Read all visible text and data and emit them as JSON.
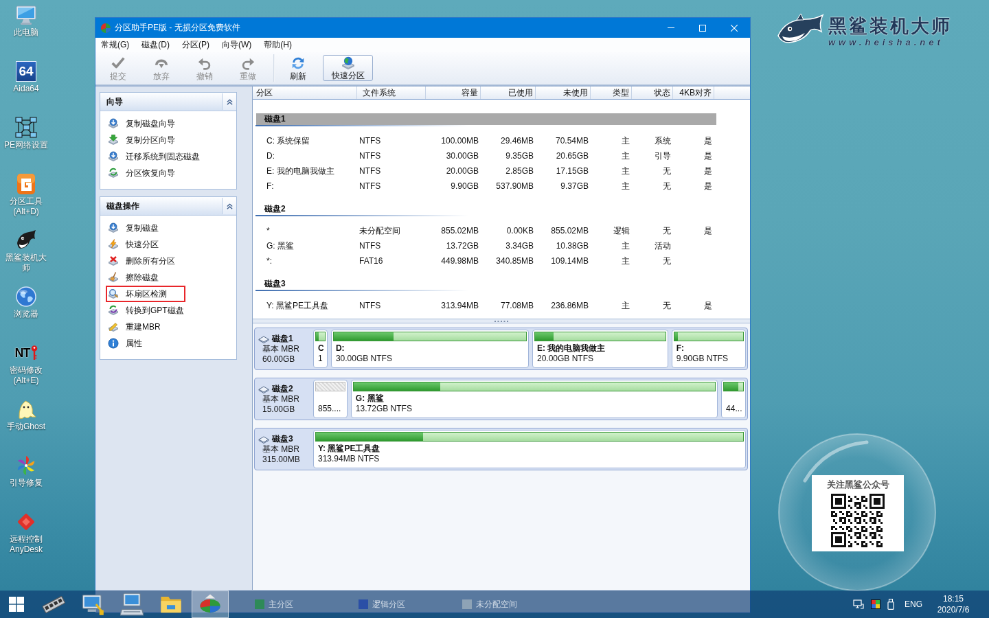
{
  "desktop_icons": [
    {
      "kind": "computer",
      "label": "此电脑"
    },
    {
      "kind": "aida",
      "label": "Aida64",
      "icon_text": "64"
    },
    {
      "kind": "network",
      "label": "PE网络设置"
    },
    {
      "kind": "partition-tool",
      "label": "分区工具(Alt+D)"
    },
    {
      "kind": "shark",
      "label": "黑鲨装机大师"
    },
    {
      "kind": "browser",
      "label": "浏览器"
    },
    {
      "kind": "password",
      "label": "密码修改(Alt+E)",
      "icon_text": "NT"
    },
    {
      "kind": "ghost",
      "label": "手动Ghost"
    },
    {
      "kind": "repair",
      "label": "引导修复"
    },
    {
      "kind": "anydesk",
      "label": "远程控制AnyDesk"
    }
  ],
  "brand": {
    "name": "黑鲨装机大师",
    "url": "www.heisha.net"
  },
  "qr_card": {
    "title": "关注黑鲨公众号"
  },
  "window": {
    "title": "分区助手PE版 - 无损分区免费软件"
  },
  "menu": [
    "常规(G)",
    "磁盘(D)",
    "分区(P)",
    "向导(W)",
    "帮助(H)"
  ],
  "toolbar": [
    {
      "buttons": [
        {
          "kind": "commit",
          "label": "提交",
          "disabled": true,
          "highlighted": false
        },
        {
          "kind": "discard",
          "label": "放弃",
          "disabled": true,
          "highlighted": false
        },
        {
          "kind": "undo",
          "label": "撤销",
          "disabled": true,
          "highlighted": false
        },
        {
          "kind": "redo",
          "label": "重做",
          "disabled": true,
          "highlighted": false
        }
      ]
    },
    {
      "buttons": [
        {
          "kind": "refresh",
          "label": "刷新",
          "disabled": false,
          "highlighted": false
        },
        {
          "kind": "quick-partition",
          "label": "快速分区",
          "disabled": false,
          "highlighted": true
        }
      ]
    }
  ],
  "sidebar": {
    "panels": [
      {
        "title": "向导",
        "expanded": true,
        "items": [
          {
            "kind": "copy-disk",
            "label": "复制磁盘向导",
            "highlighted": false
          },
          {
            "kind": "copy-partition",
            "label": "复制分区向导",
            "highlighted": false
          },
          {
            "kind": "migrate",
            "label": "迁移系统到固态磁盘",
            "highlighted": false
          },
          {
            "kind": "recover",
            "label": "分区恢复向导",
            "highlighted": false
          }
        ]
      },
      {
        "title": "磁盘操作",
        "expanded": true,
        "items": [
          {
            "kind": "copy-disk",
            "label": "复制磁盘",
            "highlighted": false
          },
          {
            "kind": "quick-partition",
            "label": "快速分区",
            "highlighted": false
          },
          {
            "kind": "delete-all",
            "label": "删除所有分区",
            "highlighted": false
          },
          {
            "kind": "wipe",
            "label": "擦除磁盘",
            "highlighted": false
          },
          {
            "kind": "bad-sector",
            "label": "坏扇区检测",
            "highlighted": true
          },
          {
            "kind": "convert-gpt",
            "label": "转换到GPT磁盘",
            "highlighted": false
          },
          {
            "kind": "rebuild-mbr",
            "label": "重建MBR",
            "highlighted": false
          },
          {
            "kind": "properties",
            "label": "属性",
            "highlighted": false
          }
        ]
      }
    ]
  },
  "partition_table": {
    "columns": [
      "分区",
      "文件系统",
      "容量",
      "已使用",
      "未使用",
      "类型",
      "状态",
      "4KB对齐"
    ],
    "disks": [
      {
        "name": "磁盘1",
        "selected": true,
        "rows": [
          [
            "C: 系统保留",
            "NTFS",
            "100.00MB",
            "29.46MB",
            "70.54MB",
            "主",
            "系统",
            "是"
          ],
          [
            "D:",
            "NTFS",
            "30.00GB",
            "9.35GB",
            "20.65GB",
            "主",
            "引导",
            "是"
          ],
          [
            "E: 我的电脑我做主",
            "NTFS",
            "20.00GB",
            "2.85GB",
            "17.15GB",
            "主",
            "无",
            "是"
          ],
          [
            "F:",
            "NTFS",
            "9.90GB",
            "537.90MB",
            "9.37GB",
            "主",
            "无",
            "是"
          ]
        ]
      },
      {
        "name": "磁盘2",
        "selected": false,
        "rows": [
          [
            "*",
            "未分配空间",
            "855.02MB",
            "0.00KB",
            "855.02MB",
            "逻辑",
            "无",
            "是"
          ],
          [
            "G: 黑鲨",
            "NTFS",
            "13.72GB",
            "3.34GB",
            "10.38GB",
            "主",
            "活动"
          ],
          [
            "*:",
            "FAT16",
            "449.98MB",
            "340.85MB",
            "109.14MB",
            "主",
            "无"
          ]
        ]
      },
      {
        "name": "磁盘3",
        "selected": false,
        "rows": [
          [
            "Y: 黑鲨PE工具盘",
            "NTFS",
            "313.94MB",
            "77.08MB",
            "236.86MB",
            "主",
            "无",
            "是"
          ]
        ]
      }
    ]
  },
  "disk_map": [
    {
      "name": "磁盘1",
      "type": "基本 MBR",
      "size": "60.00GB",
      "partitions": [
        {
          "kind": "primary",
          "label": "C",
          "detail": "1",
          "level": 0.29
        },
        {
          "kind": "primary",
          "label": "D:",
          "detail": "30.00GB NTFS",
          "level": 0.31
        },
        {
          "kind": "primary",
          "label": "E: 我的电脑我做主",
          "detail": "20.00GB NTFS",
          "level": 0.14
        },
        {
          "kind": "primary",
          "label": "F:",
          "detail": "9.90GB NTFS",
          "level": 0.05
        }
      ]
    },
    {
      "name": "磁盘2",
      "type": "基本 MBR",
      "size": "15.00GB",
      "partitions": [
        {
          "kind": "unallocated",
          "detail": "855...."
        },
        {
          "kind": "primary",
          "label": "G: 黑鲨",
          "detail": "13.72GB NTFS",
          "level": 0.24
        },
        {
          "kind": "primary",
          "detail": "44...",
          "level": 0.76
        }
      ]
    },
    {
      "name": "磁盘3",
      "type": "基本 MBR",
      "size": "315.00MB",
      "partitions": [
        {
          "kind": "primary",
          "label": "Y: 黑鲨PE工具盘",
          "detail": "313.94MB NTFS",
          "level": 0.25
        }
      ]
    }
  ],
  "legend": [
    {
      "label": "主分区",
      "color": "#2e8a58"
    },
    {
      "label": "逻辑分区",
      "color": "#2b4fa6"
    },
    {
      "label": "未分配空间",
      "color": "#8ea3b6"
    }
  ],
  "taskbar": {
    "apps": [
      {
        "kind": "memory",
        "active": false
      },
      {
        "kind": "network",
        "active": false
      },
      {
        "kind": "computer",
        "active": false
      },
      {
        "kind": "folder",
        "active": false
      },
      {
        "kind": "partition",
        "active": true
      }
    ],
    "tray": [
      {
        "kind": "network"
      },
      {
        "kind": "color"
      },
      {
        "kind": "usb"
      }
    ],
    "language": "ENG",
    "time": "18:15",
    "date": "2020/7/6"
  }
}
